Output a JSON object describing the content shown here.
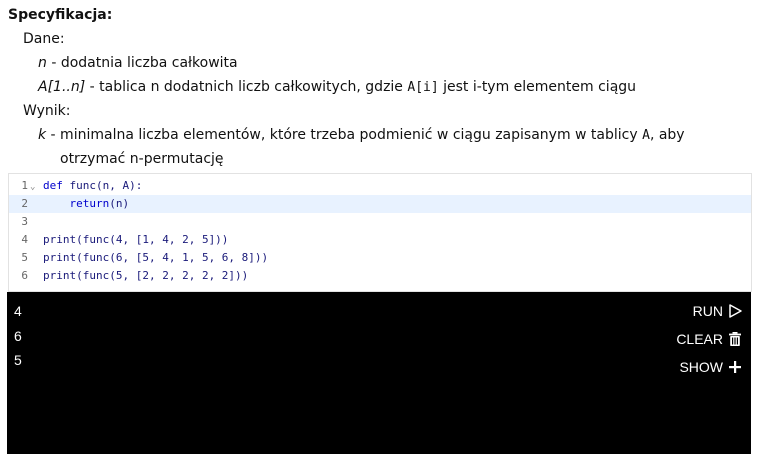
{
  "spec": {
    "title": "Specyfikacja:",
    "dane_label": "Dane:",
    "n_name": "n",
    "n_desc": " - dodatnia liczba całkowita",
    "a_name": "A[1..n]",
    "a_desc_before": " - tablica n dodatnich liczb całkowitych, gdzie ",
    "a_code": "A[i]",
    "a_desc_after": " jest i-tym elementem ciągu",
    "wynik_label": "Wynik:",
    "k_name": "k",
    "k_desc_before": " - minimalna liczba elementów, które trzeba podmienić w ciągu zapisanym w tablicy ",
    "k_code": "A",
    "k_desc_after": ", aby",
    "k_desc_line2": "otrzymać n-permutację"
  },
  "editor": {
    "active_line": 2,
    "lines": [
      {
        "num": "1",
        "text": "func(n, A):",
        "keyword": "def"
      },
      {
        "num": "2",
        "text": "(n)",
        "keyword": "    return"
      },
      {
        "num": "3",
        "text": "",
        "keyword": ""
      },
      {
        "num": "4",
        "text": "print(func(4, [1, 4, 2, 5]))",
        "keyword": ""
      },
      {
        "num": "5",
        "text": "print(func(6, [5, 4, 1, 5, 6, 8]))",
        "keyword": ""
      },
      {
        "num": "6",
        "text": "print(func(5, [2, 2, 2, 2, 2]))",
        "keyword": ""
      }
    ]
  },
  "console": {
    "output": [
      "4",
      "6",
      "5"
    ],
    "run_label": "RUN",
    "clear_label": "CLEAR",
    "show_label": "SHOW",
    "icons": {
      "run": "play-outline-icon",
      "clear": "trash-icon",
      "show": "plus-icon"
    }
  }
}
